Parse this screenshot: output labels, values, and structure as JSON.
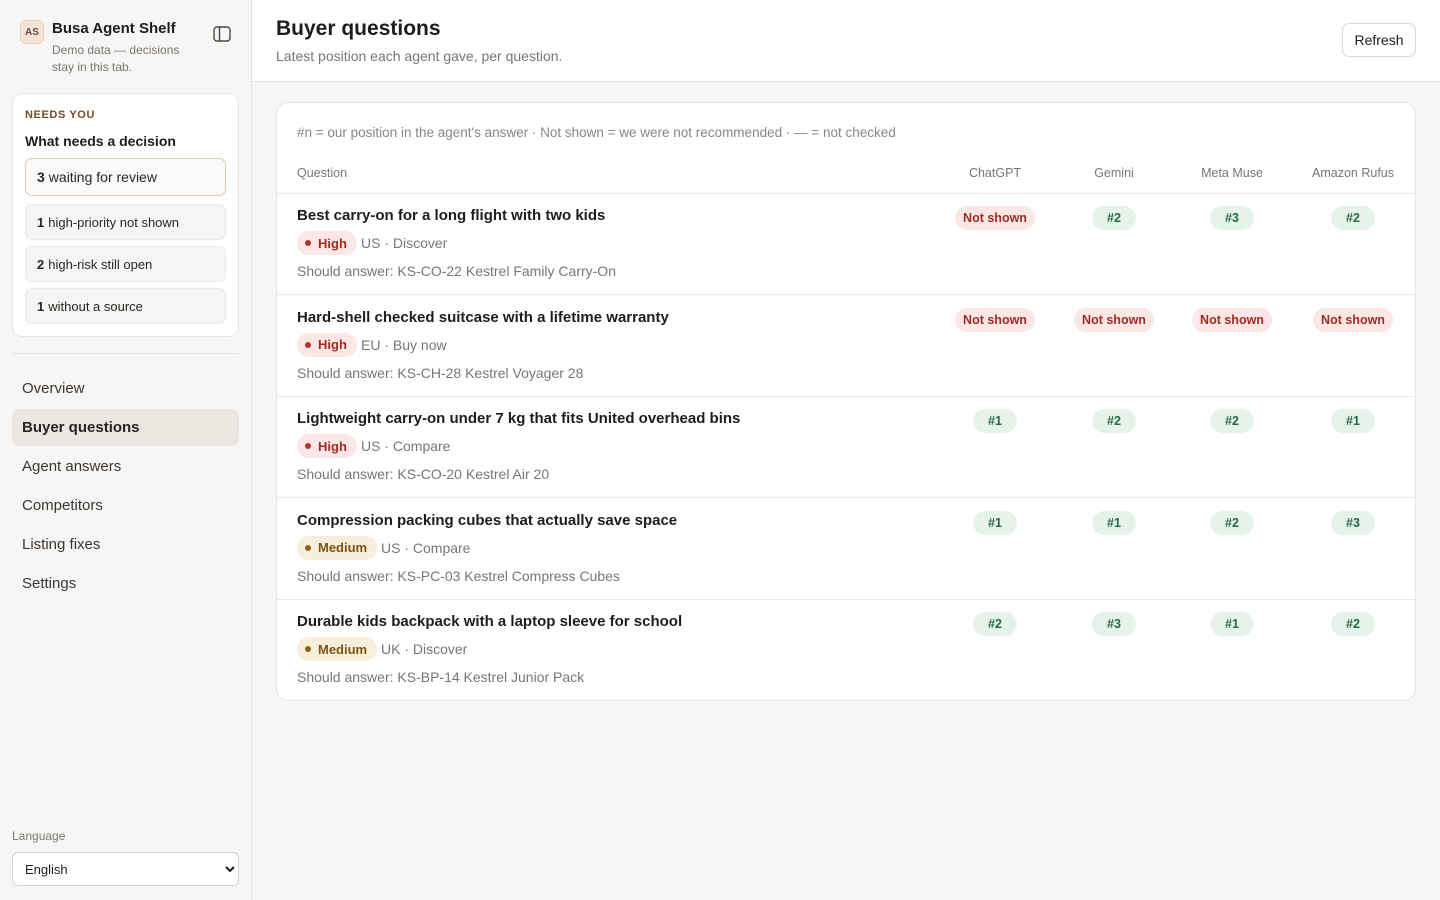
{
  "brand": {
    "initials": "AS",
    "name": "Busa Agent Shelf",
    "subtitle": "Demo data — decisions stay in this tab."
  },
  "needs_you": {
    "kicker": "NEEDS YOU",
    "title": "What needs a decision",
    "items": [
      {
        "count": "3",
        "label": "waiting for review"
      },
      {
        "count": "1",
        "label": "high-priority not shown"
      },
      {
        "count": "2",
        "label": "high-risk still open"
      },
      {
        "count": "1",
        "label": "without a source"
      }
    ]
  },
  "nav": {
    "items": [
      "Overview",
      "Buyer questions",
      "Agent answers",
      "Competitors",
      "Listing fixes",
      "Settings"
    ],
    "active": "Buyer questions"
  },
  "language": {
    "label": "Language",
    "selected": "English"
  },
  "header": {
    "title": "Buyer questions",
    "subtitle": "Latest position each agent gave, per question.",
    "refresh_label": "Refresh"
  },
  "table": {
    "legend": "#n = our position in the agent's answer · Not shown = we were not recommended · — = not checked",
    "columns": [
      "Question",
      "ChatGPT",
      "Gemini",
      "Meta Muse",
      "Amazon Rufus"
    ],
    "rows": [
      {
        "question": "Best carry-on for a long flight with two kids",
        "priority": "High",
        "priority_level": "high",
        "meta": "US · Discover",
        "should_answer": "Should answer: KS-CO-22 Kestrel Family Carry-On",
        "cells": [
          "Not shown",
          "#2",
          "#3",
          "#2"
        ]
      },
      {
        "question": "Hard-shell checked suitcase with a lifetime warranty",
        "priority": "High",
        "priority_level": "high",
        "meta": "EU · Buy now",
        "should_answer": "Should answer: KS-CH-28 Kestrel Voyager 28",
        "cells": [
          "Not shown",
          "Not shown",
          "Not shown",
          "Not shown"
        ]
      },
      {
        "question": "Lightweight carry-on under 7 kg that fits United overhead bins",
        "priority": "High",
        "priority_level": "high",
        "meta": "US · Compare",
        "should_answer": "Should answer: KS-CO-20 Kestrel Air 20",
        "cells": [
          "#1",
          "#2",
          "#2",
          "#1"
        ]
      },
      {
        "question": "Compression packing cubes that actually save space",
        "priority": "Medium",
        "priority_level": "medium",
        "meta": "US · Compare",
        "should_answer": "Should answer: KS-PC-03 Kestrel Compress Cubes",
        "cells": [
          "#1",
          "#1",
          "#2",
          "#3"
        ]
      },
      {
        "question": "Durable kids backpack with a laptop sleeve for school",
        "priority": "Medium",
        "priority_level": "medium",
        "meta": "UK · Discover",
        "should_answer": "Should answer: KS-BP-14 Kestrel Junior Pack",
        "cells": [
          "#2",
          "#3",
          "#1",
          "#2"
        ]
      }
    ]
  }
}
